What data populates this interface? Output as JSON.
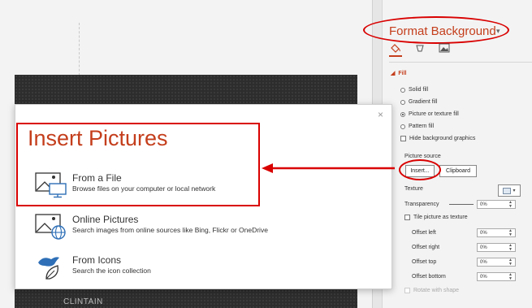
{
  "slide": {
    "caption": "CLINTAIN"
  },
  "format_pane": {
    "title": "Format Background",
    "dropdown_glyph": "▾",
    "tab_icons": [
      "fill-line-icon",
      "effects-icon",
      "picture-icon"
    ],
    "fill_section": {
      "header": "Fill",
      "options": [
        {
          "label": "Solid fill",
          "checked": false
        },
        {
          "label": "Gradient fill",
          "checked": false
        },
        {
          "label": "Picture or texture fill",
          "checked": true
        },
        {
          "label": "Pattern fill",
          "checked": false
        }
      ],
      "hide_bg_label": "Hide background graphics"
    },
    "picture_source_label": "Picture source",
    "insert_button": "Insert...",
    "clipboard_button": "Clipboard",
    "texture_label": "Texture",
    "transparency_label": "Transparency",
    "transparency_value": "0%",
    "tile_label": "Tile picture as texture",
    "offsets": [
      {
        "label": "Offset left",
        "value": "0%"
      },
      {
        "label": "Offset right",
        "value": "0%"
      },
      {
        "label": "Offset top",
        "value": "0%"
      },
      {
        "label": "Offset bottom",
        "value": "0%"
      }
    ],
    "rotate_label": "Rotate with shape"
  },
  "dialog": {
    "title": "Insert Pictures",
    "close_glyph": "×",
    "options": [
      {
        "title": "From a File",
        "desc": "Browse files on your computer or local network",
        "icon": "picture-computer-icon"
      },
      {
        "title": "Online Pictures",
        "desc": "Search images from online sources like Bing, Flickr or OneDrive",
        "icon": "picture-globe-icon"
      },
      {
        "title": "From Icons",
        "desc": "Search the icon collection",
        "icon": "bird-leaf-icon"
      }
    ]
  },
  "colors": {
    "accent": "#c43e1c",
    "annotation": "#d90000"
  }
}
